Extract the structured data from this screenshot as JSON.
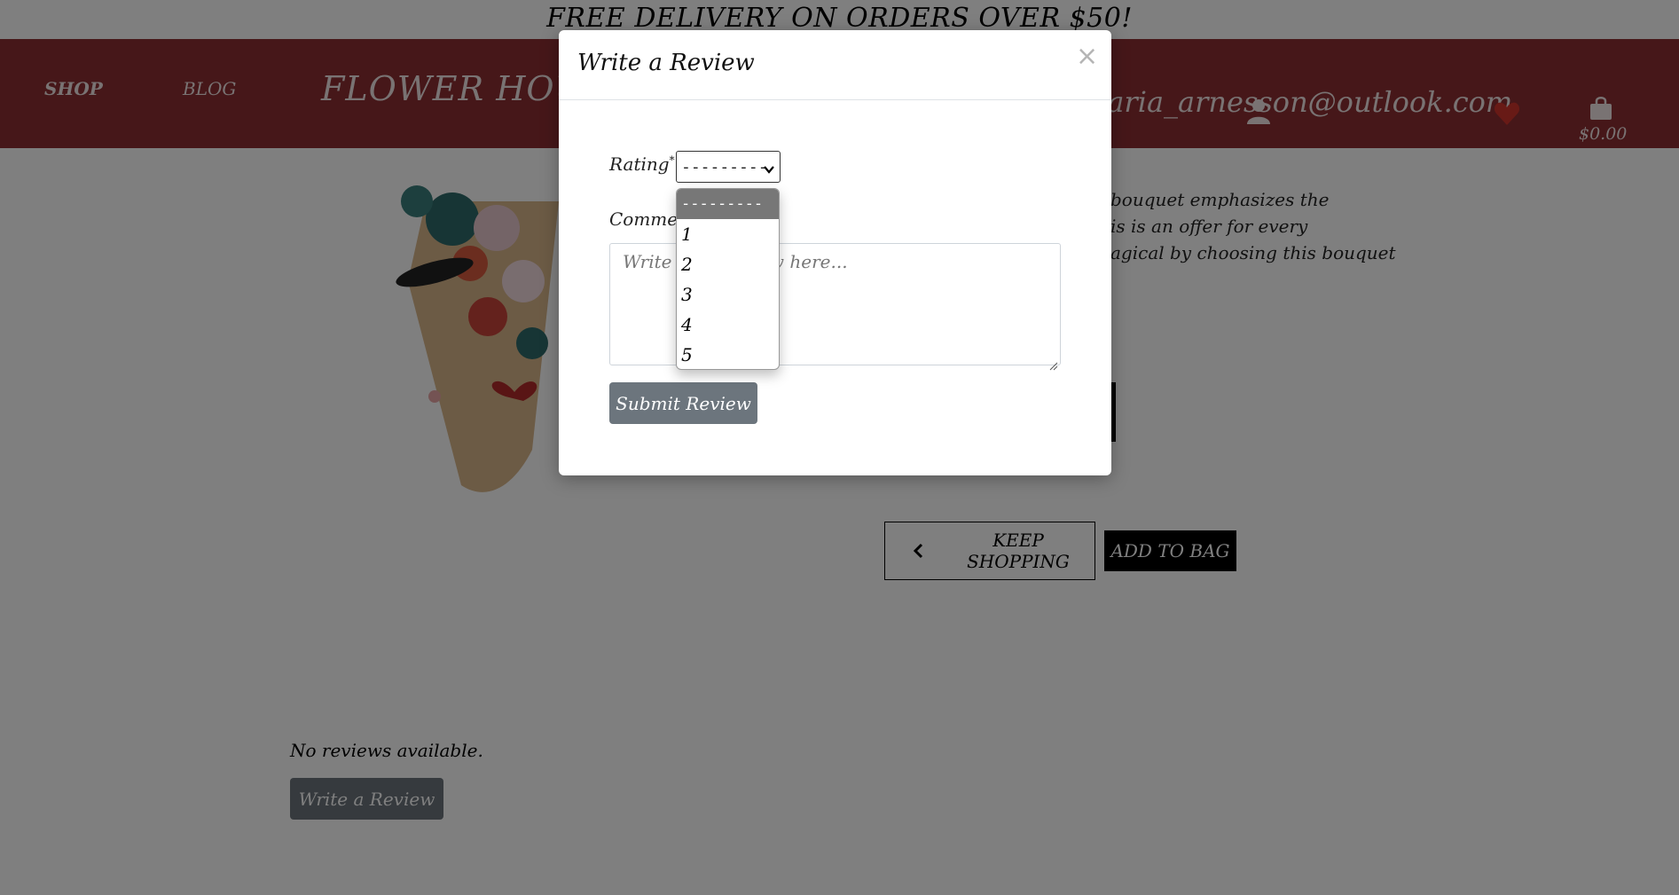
{
  "banner": {
    "text": "FREE DELIVERY ON ORDERS OVER $50!"
  },
  "nav": {
    "shop": "SHOP",
    "blog": "BLOG",
    "brand": "FLOWER HOUSE",
    "user_email": "maria_arnesson@outlook.com",
    "bag_total": "$0.00"
  },
  "product": {
    "description_lines": [
      "bouquet emphasizes the",
      "is is an offer for every",
      "agical by choosing this bouquet"
    ]
  },
  "actions": {
    "keep_shopping": "KEEP SHOPPING",
    "add_to_bag": "ADD TO BAG"
  },
  "reviews": {
    "empty_text": "No reviews available.",
    "write_button": "Write a Review"
  },
  "modal": {
    "title": "Write a Review",
    "close": "×",
    "rating_label": "Rating",
    "required_mark": "*",
    "rating_value": "---------",
    "rating_options": [
      "---------",
      "1",
      "2",
      "3",
      "4",
      "5"
    ],
    "comment_label": "Comment",
    "comment_placeholder": "Write your review here...",
    "submit": "Submit Review"
  },
  "colors": {
    "navbar": "#8c2f32",
    "button_gray": "#6c757d",
    "heart": "#d0342c"
  }
}
